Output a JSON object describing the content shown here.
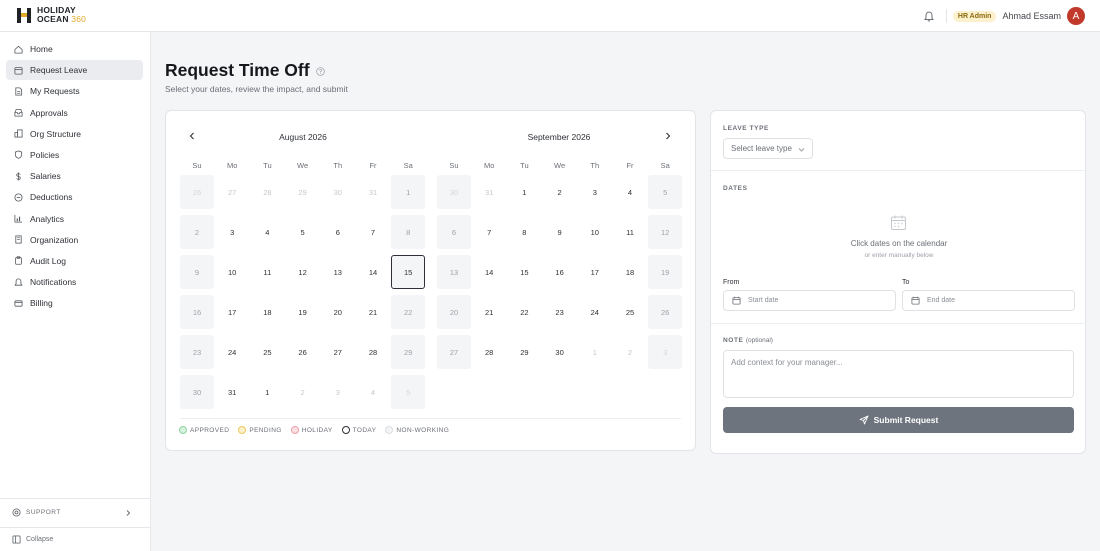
{
  "app": {
    "logo_line1": "HOLIDAY",
    "logo_line2": "OCEAN",
    "logo_suffix": "360",
    "brand_color": "#e0a92a"
  },
  "topbar": {
    "notification_icon": "bell-icon",
    "role_badge": "HR Admin",
    "user_name": "Ahmad Essam",
    "avatar_initial": "A",
    "avatar_color": "#c0392b"
  },
  "sidebar": {
    "items": [
      {
        "label": "Home",
        "icon": "home-icon",
        "active": false
      },
      {
        "label": "Request Leave",
        "icon": "calendar-icon",
        "active": true
      },
      {
        "label": "My Requests",
        "icon": "document-icon",
        "active": false
      },
      {
        "label": "Approvals",
        "icon": "inbox-icon",
        "active": false
      },
      {
        "label": "Org Structure",
        "icon": "org-chart-icon",
        "active": false
      },
      {
        "label": "Policies",
        "icon": "shield-icon",
        "active": false
      },
      {
        "label": "Salaries",
        "icon": "dollar-icon",
        "active": false
      },
      {
        "label": "Deductions",
        "icon": "minus-circle-icon",
        "active": false
      },
      {
        "label": "Analytics",
        "icon": "bar-chart-icon",
        "active": false
      },
      {
        "label": "Organization",
        "icon": "building-icon",
        "active": false
      },
      {
        "label": "Audit Log",
        "icon": "clipboard-icon",
        "active": false
      },
      {
        "label": "Notifications",
        "icon": "bell-icon",
        "active": false
      },
      {
        "label": "Billing",
        "icon": "credit-card-icon",
        "active": false
      }
    ],
    "support_label": "SUPPORT",
    "collapse_label": "Collapse"
  },
  "page": {
    "title": "Request Time Off",
    "subtitle": "Select your dates, review the impact, and submit"
  },
  "calendar": {
    "weekdays": [
      "Su",
      "Mo",
      "Tu",
      "We",
      "Th",
      "Fr",
      "Sa"
    ],
    "months": [
      {
        "title": "August 2026",
        "weeks": [
          [
            "26",
            "27",
            "28",
            "29",
            "30",
            "31",
            "1"
          ],
          [
            "2",
            "3",
            "4",
            "5",
            "6",
            "7",
            "8"
          ],
          [
            "9",
            "10",
            "11",
            "12",
            "13",
            "14",
            "15"
          ],
          [
            "16",
            "17",
            "18",
            "19",
            "20",
            "21",
            "22"
          ],
          [
            "23",
            "24",
            "25",
            "26",
            "27",
            "28",
            "29"
          ],
          [
            "30",
            "31",
            "1",
            "2",
            "3",
            "4",
            "5"
          ]
        ],
        "first_in_month_index": 6,
        "last_in_month_index": 37,
        "today_index": 20
      },
      {
        "title": "September 2026",
        "weeks": [
          [
            "30",
            "31",
            "1",
            "2",
            "3",
            "4",
            "5"
          ],
          [
            "6",
            "7",
            "8",
            "9",
            "10",
            "11",
            "12"
          ],
          [
            "13",
            "14",
            "15",
            "16",
            "17",
            "18",
            "19"
          ],
          [
            "20",
            "21",
            "22",
            "23",
            "24",
            "25",
            "26"
          ],
          [
            "27",
            "28",
            "29",
            "30",
            "1",
            "2",
            "3"
          ]
        ],
        "first_in_month_index": 2,
        "last_in_month_index": 31,
        "today_index": -1
      }
    ],
    "legend": [
      {
        "label": "APPROVED",
        "color": "#d6f1dc",
        "border": "#8fd3a2"
      },
      {
        "label": "PENDING",
        "color": "#fdf0cc",
        "border": "#ecc95a"
      },
      {
        "label": "HOLIDAY",
        "color": "#fbe0e3",
        "border": "#ee9fa8"
      },
      {
        "label": "TODAY",
        "color": "#ffffff",
        "border": "#2d3036"
      },
      {
        "label": "NON-WORKING",
        "color": "#f4f5f7",
        "border": "#dadde1"
      }
    ]
  },
  "form": {
    "leave_type_label": "LEAVE TYPE",
    "leave_type_placeholder": "Select leave type",
    "dates_label": "DATES",
    "dates_empty_main": "Click dates on the calendar",
    "dates_empty_sub": "or enter manually below",
    "from_label": "From",
    "from_placeholder": "Start date",
    "to_label": "To",
    "to_placeholder": "End date",
    "note_label": "NOTE",
    "note_optional": "(optional)",
    "note_placeholder": "Add context for your manager...",
    "submit_label": "Submit Request"
  }
}
